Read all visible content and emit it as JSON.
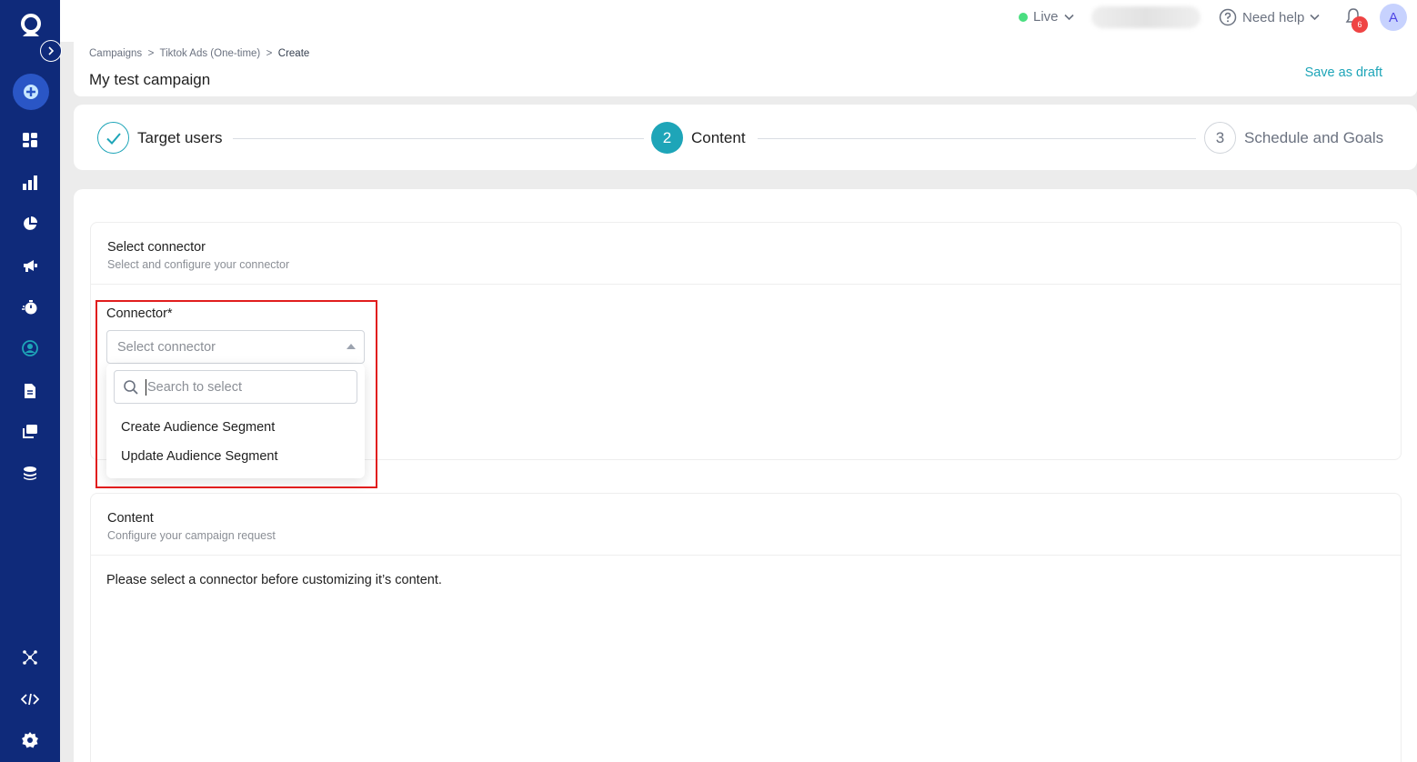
{
  "topbar": {
    "environment": "Live",
    "help_label": "Need help",
    "notification_count": "6",
    "avatar_initial": "A"
  },
  "header": {
    "breadcrumb": [
      "Campaigns",
      "Tiktok Ads (One-time)",
      "Create"
    ],
    "title": "My test campaign",
    "save_draft_label": "Save as draft"
  },
  "stepper": {
    "steps": [
      {
        "number": "1",
        "label": "Target users",
        "status": "done"
      },
      {
        "number": "2",
        "label": "Content",
        "status": "active"
      },
      {
        "number": "3",
        "label": "Schedule and Goals",
        "status": "todo"
      }
    ]
  },
  "connector_section": {
    "title": "Select connector",
    "subtitle": "Select and configure your connector",
    "field_label": "Connector*",
    "select_placeholder": "Select connector",
    "search_placeholder": "Search to select",
    "options": [
      "Create Audience Segment",
      "Update Audience Segment"
    ]
  },
  "content_section": {
    "title": "Content",
    "subtitle": "Configure your campaign request",
    "message": "Please select a connector before customizing it’s content."
  },
  "colors": {
    "sidebar": "#0f2a7a",
    "accent": "#1ea5b8",
    "highlight": "#e11d1d",
    "live_dot": "#4ade80",
    "badge": "#ef4444"
  }
}
